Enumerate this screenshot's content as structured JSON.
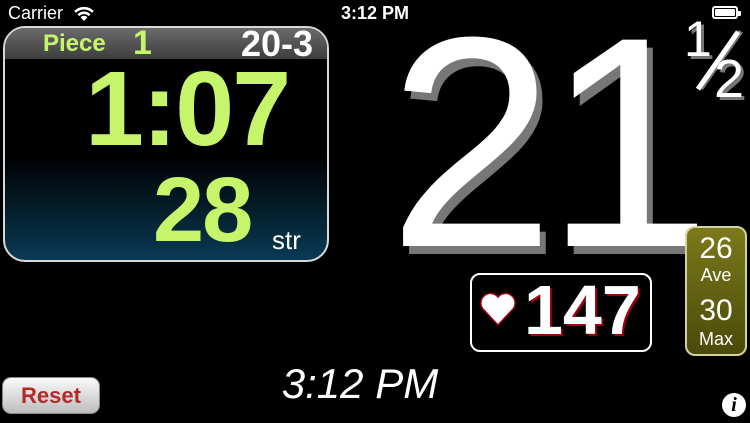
{
  "status_bar": {
    "carrier": "Carrier",
    "time": "3:12 PM"
  },
  "monitor": {
    "piece_label": "Piece",
    "piece_number": "1",
    "workout": "20-3",
    "elapsed_time": "1:07",
    "stroke_rate": "28",
    "stroke_rate_unit": "str"
  },
  "pace": {
    "value": "21",
    "fraction_numerator": "1",
    "fraction_denominator": "2"
  },
  "heart_rate": {
    "value": "147"
  },
  "stats": {
    "ave_value": "26",
    "ave_label": "Ave",
    "max_value": "30",
    "max_label": "Max"
  },
  "footer": {
    "reset_label": "Reset",
    "time": "3:12 PM",
    "info_label": "i"
  },
  "colors": {
    "accent_green": "#c6f56b",
    "stats_olive": "#6b6a14",
    "reset_text": "#b22a2a"
  }
}
